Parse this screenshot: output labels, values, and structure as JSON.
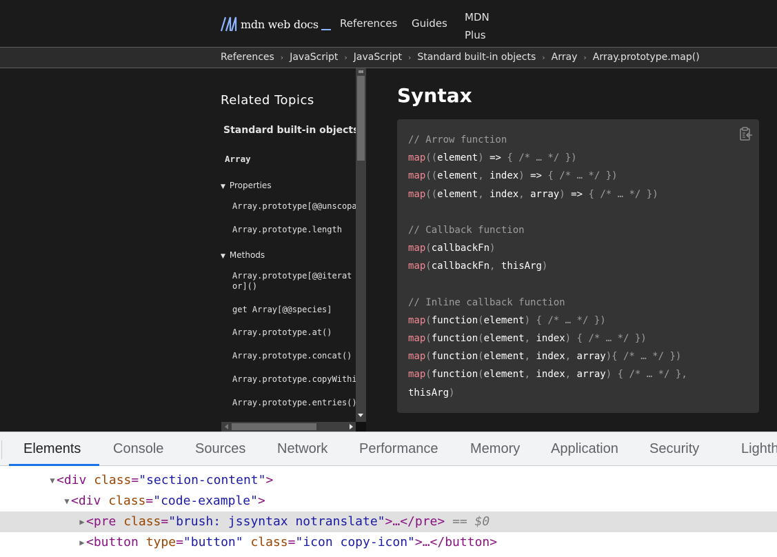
{
  "header": {
    "logo_text": "mdn web docs",
    "nav": [
      {
        "label": "References"
      },
      {
        "label": "Guides"
      },
      {
        "label": "MDN Plus"
      }
    ],
    "brand_accent": "#8cb4ff"
  },
  "breadcrumb": [
    {
      "label": "References"
    },
    {
      "label": "JavaScript"
    },
    {
      "label": "JavaScript"
    },
    {
      "label": "Standard built-in objects"
    },
    {
      "label": "Array"
    },
    {
      "label": "Array.prototype.map()"
    }
  ],
  "sidebar": {
    "title": "Related Topics",
    "section": "Standard built-in objects",
    "object": "Array",
    "groups": [
      {
        "label": "Properties",
        "items": [
          "Array.prototype[@@unscopables]",
          "Array.prototype.length"
        ]
      },
      {
        "label": "Methods",
        "items": [
          "Array.prototype[@@iterator]()",
          "get Array[@@species]",
          "Array.prototype.at()",
          "Array.prototype.concat()",
          "Array.prototype.copyWithin()",
          "Array.prototype.entries()"
        ]
      }
    ]
  },
  "main": {
    "heading": "Syntax",
    "copy_icon": "clipboard-copy-icon",
    "code_lines": [
      "// Arrow function",
      "map((element) => { /* … */ })",
      "map((element, index) => { /* … */ })",
      "map((element, index, array) => { /* … */ })",
      "",
      "// Callback function",
      "map(callbackFn)",
      "map(callbackFn, thisArg)",
      "",
      "// Inline callback function",
      "map(function(element) { /* … */ })",
      "map(function(element, index) { /* … */ })",
      "map(function(element, index, array){ /* … */ })",
      "map(function(element, index, array) { /* … */ },",
      "thisArg)"
    ]
  },
  "devtools": {
    "tabs": [
      {
        "label": "Elements",
        "active": true
      },
      {
        "label": "Console"
      },
      {
        "label": "Sources"
      },
      {
        "label": "Network"
      },
      {
        "label": "Performance"
      },
      {
        "label": "Memory"
      },
      {
        "label": "Application"
      },
      {
        "label": "Security"
      },
      {
        "label": "Lighthouse"
      }
    ],
    "tree": [
      {
        "arrow": "▼",
        "tag": "div",
        "attrs": [
          {
            "name": "class",
            "value": "section-content"
          }
        ],
        "close": ">"
      },
      {
        "arrow": "▼",
        "tag": "div",
        "attrs": [
          {
            "name": "class",
            "value": "code-example"
          }
        ],
        "close": ">"
      },
      {
        "arrow": "▶",
        "tag": "pre",
        "attrs": [
          {
            "name": "class",
            "value": "brush: jssyntax notranslate"
          }
        ],
        "close": ">…</pre>",
        "selected": true,
        "ref": "== $0"
      },
      {
        "arrow": "▶",
        "tag": "button",
        "attrs": [
          {
            "name": "type",
            "value": "button"
          },
          {
            "name": "class",
            "value": "icon copy-icon"
          }
        ],
        "close": ">…</button>"
      }
    ],
    "accent": "#1a73e8"
  }
}
